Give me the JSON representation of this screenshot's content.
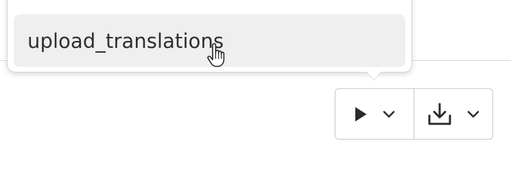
{
  "popover": {
    "item_label": "upload_translations"
  },
  "toolbar": {
    "run_icon": "play-icon",
    "run_menu_icon": "chevron-down-icon",
    "download_icon": "download-icon",
    "download_menu_icon": "chevron-down-icon"
  },
  "colors": {
    "menu_item_hover_bg": "#efefef",
    "text": "#2f2f2f",
    "border": "#c9c9c9",
    "icon": "#2b2b2b"
  }
}
